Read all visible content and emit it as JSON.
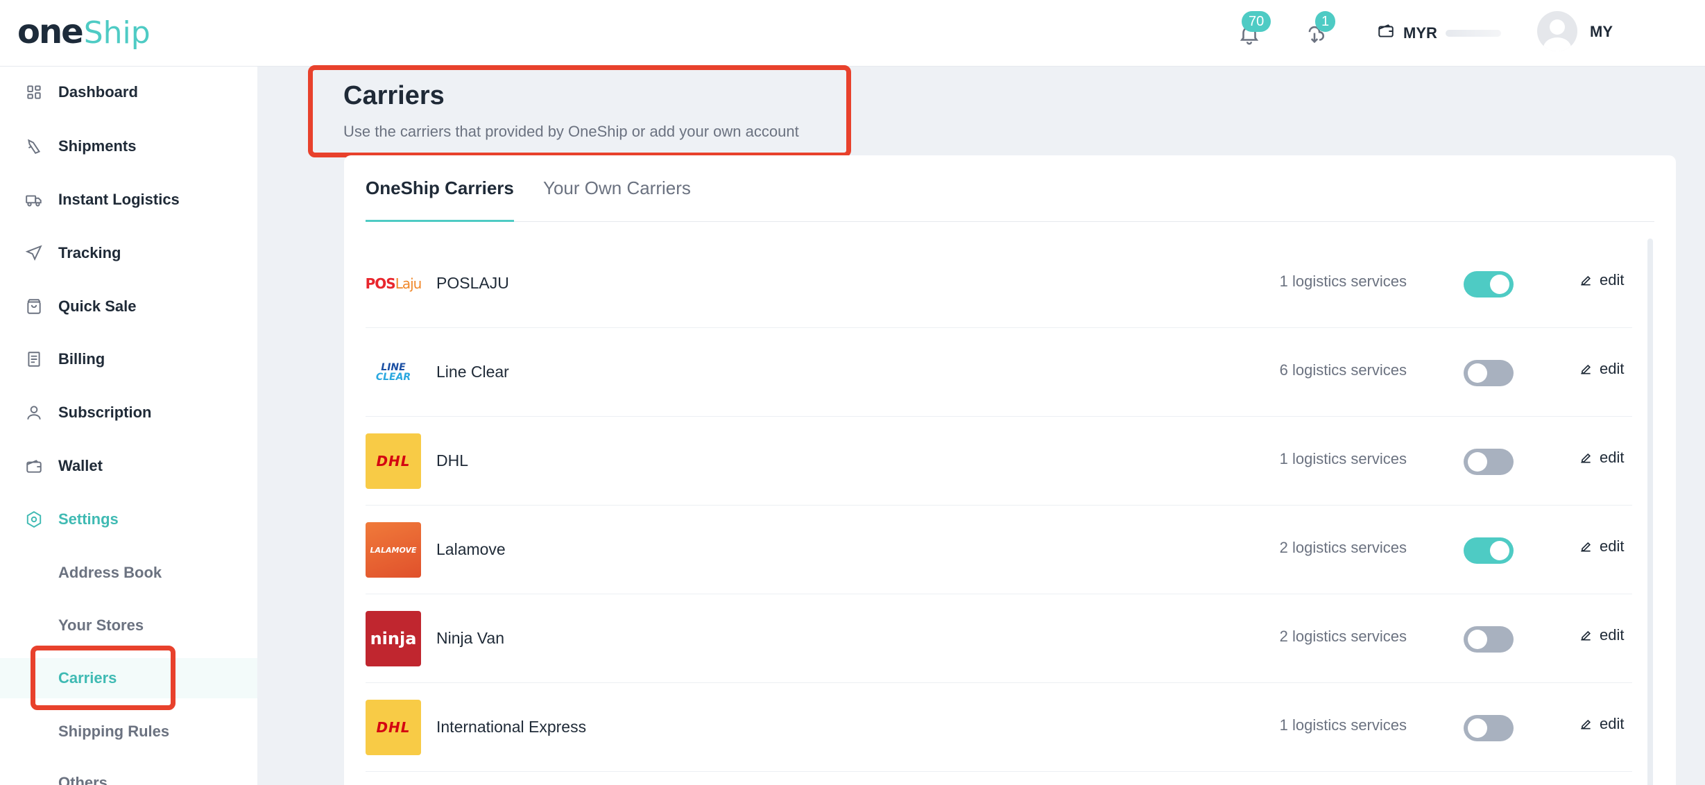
{
  "header": {
    "logo_one": "one",
    "logo_ship": "Ship",
    "notifications_count": "70",
    "downloads_count": "1",
    "currency": "MYR",
    "user": "MY"
  },
  "sidebar": {
    "items": [
      {
        "label": "Dashboard",
        "icon": "dashboard-icon"
      },
      {
        "label": "Shipments",
        "icon": "shipment-icon"
      },
      {
        "label": "Instant Logistics",
        "icon": "truck-icon"
      },
      {
        "label": "Tracking",
        "icon": "send-icon"
      },
      {
        "label": "Quick Sale",
        "icon": "bag-icon"
      },
      {
        "label": "Billing",
        "icon": "receipt-icon"
      },
      {
        "label": "Subscription",
        "icon": "user-icon"
      },
      {
        "label": "Wallet",
        "icon": "wallet-icon"
      },
      {
        "label": "Settings",
        "icon": "settings-icon"
      }
    ],
    "settings_sub": [
      {
        "label": "Address Book"
      },
      {
        "label": "Your Stores"
      },
      {
        "label": "Carriers"
      },
      {
        "label": "Shipping Rules"
      },
      {
        "label": "Others"
      }
    ]
  },
  "page": {
    "title": "Carriers",
    "subtitle": "Use the carriers that provided by OneShip or add your own account"
  },
  "tabs": {
    "active": "OneShip Carriers",
    "inactive": "Your Own Carriers"
  },
  "carriers": [
    {
      "name": "POSLAJU",
      "services": "1 logistics services",
      "enabled": true,
      "edit": "edit",
      "logo_text": "POSLaju"
    },
    {
      "name": "Line Clear",
      "services": "6 logistics services",
      "enabled": false,
      "edit": "edit",
      "logo_text": "LINE CLEAR"
    },
    {
      "name": "DHL",
      "services": "1 logistics services",
      "enabled": false,
      "edit": "edit",
      "logo_text": "DHL"
    },
    {
      "name": "Lalamove",
      "services": "2 logistics services",
      "enabled": true,
      "edit": "edit",
      "logo_text": "LALAMOVE"
    },
    {
      "name": "Ninja Van",
      "services": "2 logistics services",
      "enabled": false,
      "edit": "edit",
      "logo_text": "ninja"
    },
    {
      "name": "International Express",
      "services": "1 logistics services",
      "enabled": false,
      "edit": "edit",
      "logo_text": "DHL"
    }
  ],
  "colors": {
    "accent": "#4ecbc4",
    "highlight_box": "#e8412c"
  }
}
